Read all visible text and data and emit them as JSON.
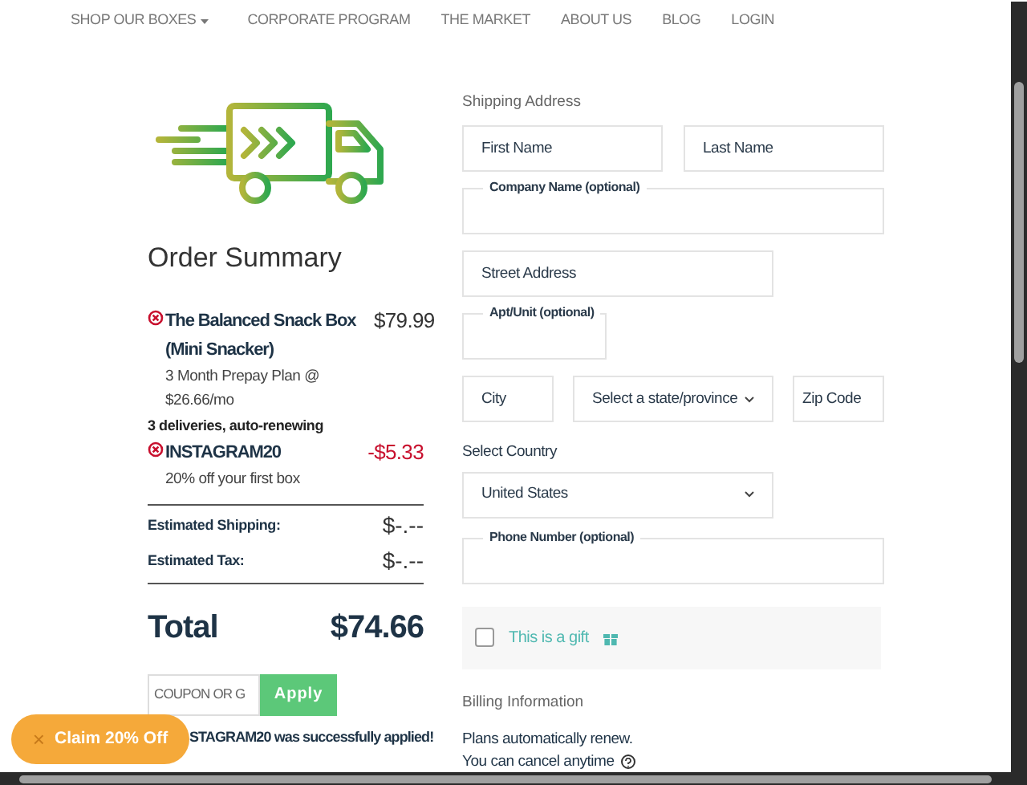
{
  "nav": [
    {
      "label": "SHOP OUR BOXES",
      "dropdown": true
    },
    {
      "label": "CORPORATE PROGRAM",
      "dropdown": false
    },
    {
      "label": "THE MARKET",
      "dropdown": false
    },
    {
      "label": "ABOUT US",
      "dropdown": false
    },
    {
      "label": "BLOG",
      "dropdown": false
    },
    {
      "label": "LOGIN",
      "dropdown": false
    }
  ],
  "summary": {
    "title": "Order Summary",
    "items": [
      {
        "kind": "product",
        "name": "The Balanced Snack Box (Mini Snacker)",
        "price": "$79.99",
        "details": [
          "3 Month Prepay Plan @ $26.66/mo"
        ],
        "note": "3 deliveries, auto-renewing"
      },
      {
        "kind": "discount",
        "name": "INSTAGRAM20",
        "price": "-$5.33",
        "details": [
          "20% off your first box"
        ]
      }
    ],
    "estimates": [
      {
        "label": "Estimated Shipping:",
        "value": "$-.--"
      },
      {
        "label": "Estimated Tax:",
        "value": "$-.--"
      }
    ],
    "total": {
      "label": "Total",
      "value": "$74.66"
    },
    "coupon": {
      "placeholder": "COUPON OR G",
      "button": "Apply"
    },
    "message": "STAGRAM20 was successfully applied!"
  },
  "promo": {
    "label": "Claim 20% Off",
    "close": "×"
  },
  "shipping": {
    "heading": "Shipping Address",
    "rows": [
      [
        {
          "kind": "input",
          "placeholder": "First Name"
        },
        {
          "kind": "input",
          "placeholder": "Last Name"
        }
      ],
      [
        {
          "kind": "floating",
          "label": "Company Name (optional)"
        }
      ],
      [
        {
          "kind": "input",
          "placeholder": "Street Address"
        }
      ],
      [
        {
          "kind": "floating",
          "label": "Apt/Unit (optional)"
        }
      ],
      [
        {
          "kind": "input",
          "placeholder": "City"
        },
        {
          "kind": "select",
          "value": "Select a state/province"
        },
        {
          "kind": "input",
          "placeholder": "Zip Code"
        }
      ],
      [
        {
          "kind": "heading",
          "label": "Select Country"
        }
      ],
      [
        {
          "kind": "select",
          "value": "United States"
        }
      ],
      [
        {
          "kind": "floating",
          "label": "Phone Number (optional)"
        }
      ]
    ],
    "gift": {
      "label": "This is a gift",
      "checked": false
    }
  },
  "billing": {
    "heading": "Billing Information",
    "lines": [
      "Plans automatically renew.",
      "You can cancel anytime"
    ]
  }
}
